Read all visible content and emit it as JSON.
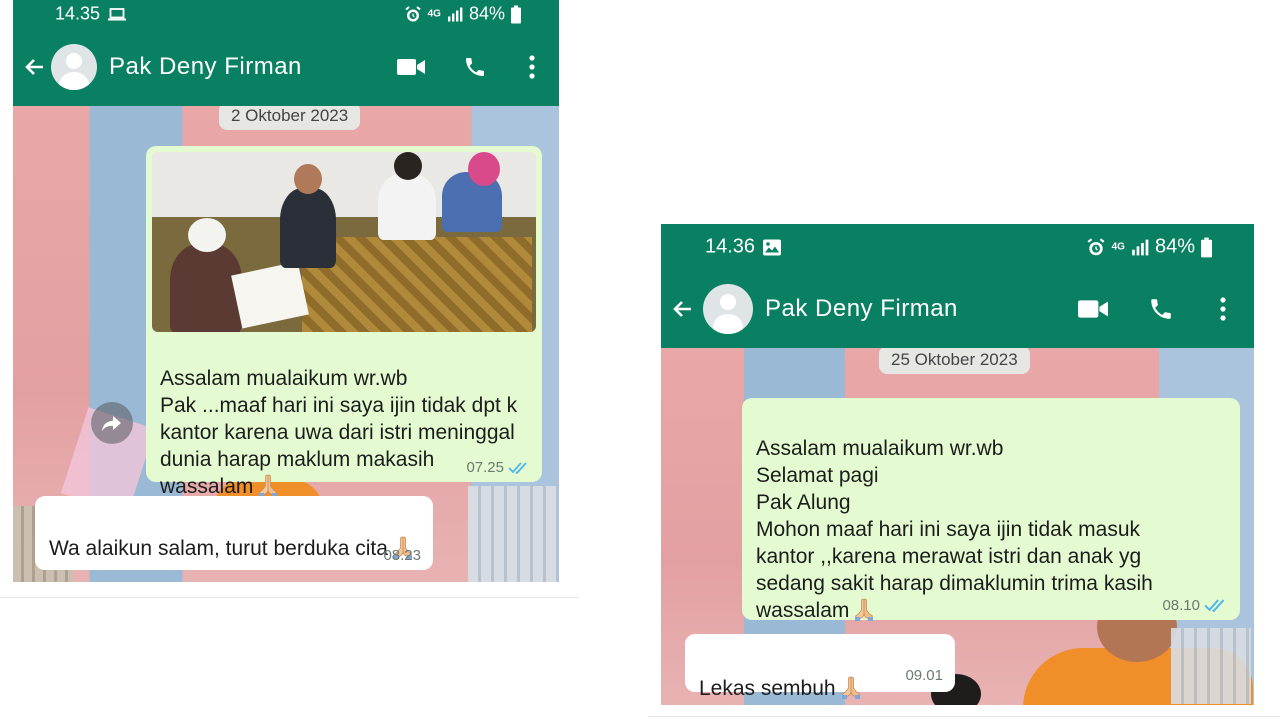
{
  "screens": [
    {
      "status": {
        "time": "14.35",
        "network": "4G",
        "battery": "84%"
      },
      "contact": {
        "name": "Pak Deny Firman"
      },
      "date_chip": "2 Oktober 2023",
      "messages": [
        {
          "direction": "outgoing",
          "has_image": true,
          "text": "Assalam mualaikum wr.wb\nPak ...maaf hari ini saya ijin tidak dpt k\nkantor karena uwa dari istri meninggal\ndunia harap maklum makasih\nwassalam",
          "time": "07.25",
          "read": true
        },
        {
          "direction": "incoming",
          "text": "Wa alaikun salam, turut berduka cita",
          "time": "08.23"
        }
      ]
    },
    {
      "status": {
        "time": "14.36",
        "network": "4G",
        "battery": "84%"
      },
      "contact": {
        "name": "Pak Deny Firman"
      },
      "date_chip": "25 Oktober 2023",
      "messages": [
        {
          "direction": "outgoing",
          "text": "Assalam mualaikum wr.wb\nSelamat pagi\nPak Alung\nMohon maaf hari ini saya ijin tidak masuk\nkantor ,,karena merawat istri dan anak yg\nsedang sakit harap dimaklumin trima kasih\nwassalam",
          "time": "08.10",
          "read": true
        },
        {
          "direction": "incoming",
          "text": "Lekas sembuh",
          "time": "09.01"
        }
      ]
    }
  ],
  "colors": {
    "header": "#0a8062",
    "outgoing_bubble": "#e4fbd2",
    "incoming_bubble": "#ffffff",
    "read_ticks": "#4fb6ec"
  },
  "icons": [
    "back-arrow-icon",
    "video-call-icon",
    "phone-call-icon",
    "more-vert-icon",
    "forward-icon",
    "praying-hands-emoji",
    "alarm-icon",
    "laptop-icon",
    "image-icon",
    "signal-icon",
    "battery-icon"
  ]
}
